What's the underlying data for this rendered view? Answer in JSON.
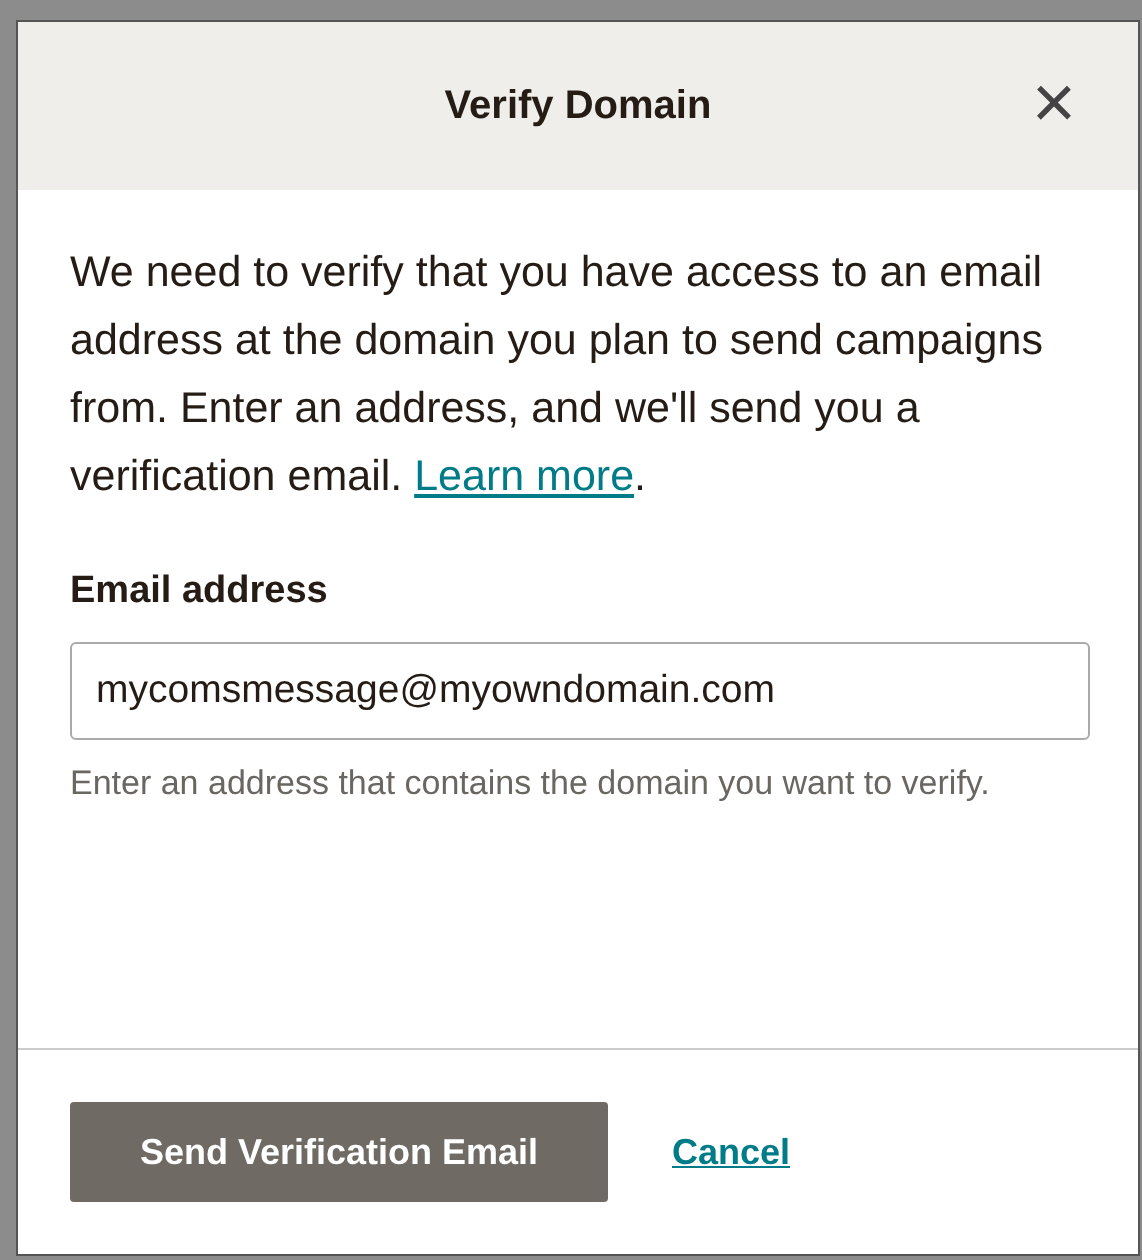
{
  "dialog": {
    "title": "Verify Domain",
    "close_icon": "×",
    "description": "We need to verify that you have access to an email address at the domain you plan to send campaigns from. Enter an address, and we'll send you a verification email.",
    "learn_more_link": "Learn more",
    "description_end": ".",
    "email_field": {
      "label": "Email address",
      "value": "mycomsmessage@myowndomain.com",
      "help": "Enter an address that contains the domain you want to verify."
    },
    "buttons": [
      {
        "kind": "primary",
        "label": "Send Verification Email"
      },
      {
        "kind": "link",
        "label": "Cancel"
      }
    ]
  }
}
